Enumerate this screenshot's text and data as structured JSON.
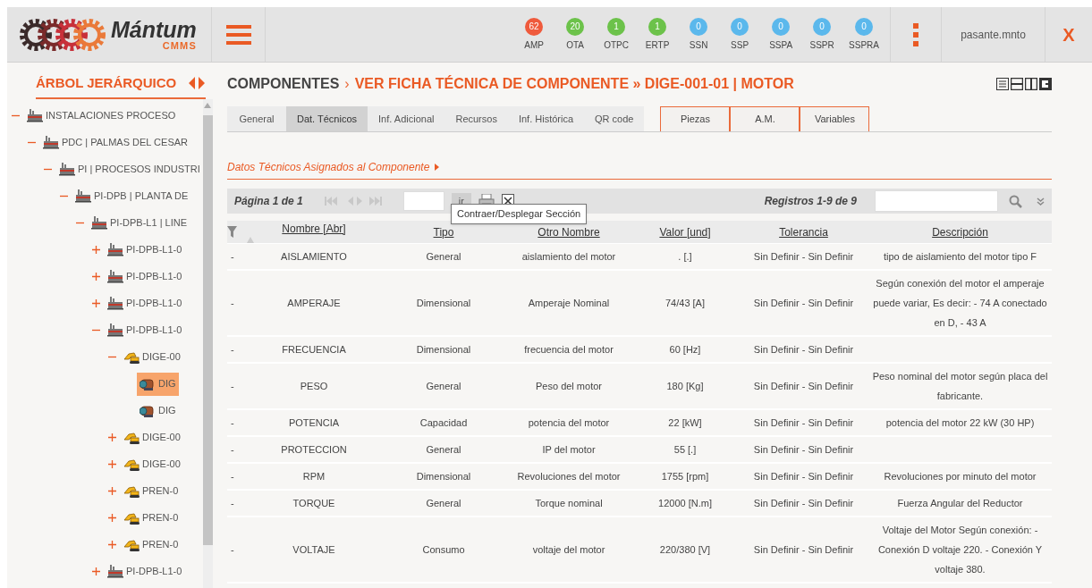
{
  "logo": {
    "name": "Mántum",
    "subtitle": "CMMS"
  },
  "counters": [
    {
      "label": "AMP",
      "count": "62",
      "color": "#ef5a3c"
    },
    {
      "label": "OTA",
      "count": "20",
      "color": "#6cc24a"
    },
    {
      "label": "OTPC",
      "count": "1",
      "color": "#6cc24a"
    },
    {
      "label": "ERTP",
      "count": "1",
      "color": "#6cc24a"
    },
    {
      "label": "SSN",
      "count": "0",
      "color": "#5bb8ec"
    },
    {
      "label": "SSP",
      "count": "0",
      "color": "#5bb8ec"
    },
    {
      "label": "SSPA",
      "count": "0",
      "color": "#5bb8ec"
    },
    {
      "label": "SSPR",
      "count": "0",
      "color": "#5bb8ec"
    },
    {
      "label": "SSPRA",
      "count": "0",
      "color": "#5bb8ec"
    }
  ],
  "user": "pasante.mnto",
  "close_label": "X",
  "sidebar": {
    "title": "ÁRBOL JERÁRQUICO",
    "tree": [
      {
        "label": "INSTALACIONES PROCESO",
        "kind": "plant",
        "expanded": true,
        "selected": false,
        "children": [
          {
            "label": "PDC | PALMAS DEL CESAR",
            "kind": "plant",
            "expanded": true,
            "selected": false,
            "children": [
              {
                "label": "PI | PROCESOS INDUSTRI",
                "kind": "plant",
                "expanded": true,
                "selected": false,
                "children": [
                  {
                    "label": "PI-DPB | PLANTA DE",
                    "kind": "plant",
                    "expanded": true,
                    "selected": false,
                    "children": [
                      {
                        "label": "PI-DPB-L1 | LINE",
                        "kind": "plant",
                        "expanded": true,
                        "selected": false,
                        "children": [
                          {
                            "label": "PI-DPB-L1-0",
                            "kind": "plant",
                            "expanded": false,
                            "selected": false
                          },
                          {
                            "label": "PI-DPB-L1-0",
                            "kind": "plant",
                            "expanded": false,
                            "selected": false
                          },
                          {
                            "label": "PI-DPB-L1-0",
                            "kind": "plant",
                            "expanded": false,
                            "selected": false
                          },
                          {
                            "label": "PI-DPB-L1-0",
                            "kind": "plant",
                            "expanded": true,
                            "selected": false,
                            "children": [
                              {
                                "label": "DIGE-00",
                                "kind": "excavator",
                                "expanded": true,
                                "selected": false,
                                "children": [
                                  {
                                    "label": "DIG",
                                    "kind": "motor",
                                    "selected": true
                                  },
                                  {
                                    "label": "DIG",
                                    "kind": "motor",
                                    "selected": false
                                  }
                                ]
                              },
                              {
                                "label": "DIGE-00",
                                "kind": "excavator",
                                "expanded": false,
                                "selected": false
                              },
                              {
                                "label": "DIGE-00",
                                "kind": "excavator",
                                "expanded": false,
                                "selected": false
                              },
                              {
                                "label": "PREN-0",
                                "kind": "excavator",
                                "expanded": false,
                                "selected": false
                              },
                              {
                                "label": "PREN-0",
                                "kind": "excavator",
                                "expanded": false,
                                "selected": false
                              },
                              {
                                "label": "PREN-0",
                                "kind": "excavator",
                                "expanded": false,
                                "selected": false
                              }
                            ]
                          },
                          {
                            "label": "PI-DPB-L1-0",
                            "kind": "plant",
                            "expanded": false,
                            "selected": false
                          }
                        ]
                      }
                    ]
                  }
                ]
              }
            ]
          }
        ]
      }
    ]
  },
  "breadcrumb": [
    {
      "text": "COMPONENTES",
      "kind": "root"
    },
    {
      "text": "›",
      "kind": "separator"
    },
    {
      "text": "VER FICHA TÉCNICA DE COMPONENTE » DIGE-001-01 | MOTOR",
      "kind": "page"
    }
  ],
  "tabs": [
    {
      "label": "General",
      "kind": "plain",
      "selected": false
    },
    {
      "label": "Dat. Técnicos",
      "kind": "plain",
      "selected": true
    },
    {
      "label": "Inf. Adicional",
      "kind": "plain",
      "selected": false
    },
    {
      "label": "Recursos",
      "kind": "plain",
      "selected": false
    },
    {
      "label": "Inf. Histórica",
      "kind": "plain",
      "selected": false
    },
    {
      "label": "QR code",
      "kind": "plain",
      "selected": false
    },
    {
      "label": "Piezas",
      "kind": "outlined",
      "selected": false
    },
    {
      "label": "A.M.",
      "kind": "outlined",
      "selected": false
    },
    {
      "label": "Variables",
      "kind": "outlined",
      "selected": false
    }
  ],
  "section_title": "Datos Técnicos Asignados al Componente",
  "toolbar": {
    "page_info": "Página 1 de 1",
    "go_button": "ir",
    "records": "Registros 1-9 de 9",
    "tooltip": "Contraer/Desplegar Sección"
  },
  "table": {
    "columns": [
      "",
      "Nombre [Abr]",
      "Tipo",
      "Otro Nombre",
      "Valor [und]",
      "Tolerancia",
      "Descripción"
    ],
    "rows": [
      [
        "-",
        "AISLAMIENTO",
        "General",
        "aislamiento del motor",
        ". [.]",
        "Sin Definir - Sin Definir",
        "tipo de aislamiento del motor tipo F"
      ],
      [
        "-",
        "AMPERAJE",
        "Dimensional",
        "Amperaje Nominal",
        "74/43 [A]",
        "Sin Definir - Sin Definir",
        "Según conexión del motor el amperaje puede variar, Es decir: - 74 A conectado en D, - 43 A"
      ],
      [
        "-",
        "FRECUENCIA",
        "Dimensional",
        "frecuencia del motor",
        "60 [Hz]",
        "Sin Definir - Sin Definir",
        ""
      ],
      [
        "-",
        "PESO",
        "General",
        "Peso del motor",
        "180 [Kg]",
        "Sin Definir - Sin Definir",
        "Peso nominal del motor según placa del fabricante."
      ],
      [
        "-",
        "POTENCIA",
        "Capacidad",
        "potencia del motor",
        "22 [kW]",
        "Sin Definir - Sin Definir",
        "potencia del motor 22 kW (30 HP)"
      ],
      [
        "-",
        "PROTECCION",
        "General",
        "IP del motor",
        "55 [.]",
        "Sin Definir - Sin Definir",
        ""
      ],
      [
        "-",
        "RPM",
        "Dimensional",
        "Revoluciones del motor",
        "1755 [rpm]",
        "Sin Definir - Sin Definir",
        "Revoluciones por minuto del motor"
      ],
      [
        "-",
        "TORQUE",
        "General",
        "Torque nominal",
        "12000 [N.m]",
        "Sin Definir - Sin Definir",
        "Fuerza Angular del Reductor"
      ],
      [
        "-",
        "VOLTAJE",
        "Consumo",
        "voltaje del motor",
        "220/380 [V]",
        "Sin Definir - Sin Definir",
        "Voltaje del Motor Según conexión: - Conexión D voltaje 220. - Conexión Y voltaje 380."
      ]
    ]
  }
}
